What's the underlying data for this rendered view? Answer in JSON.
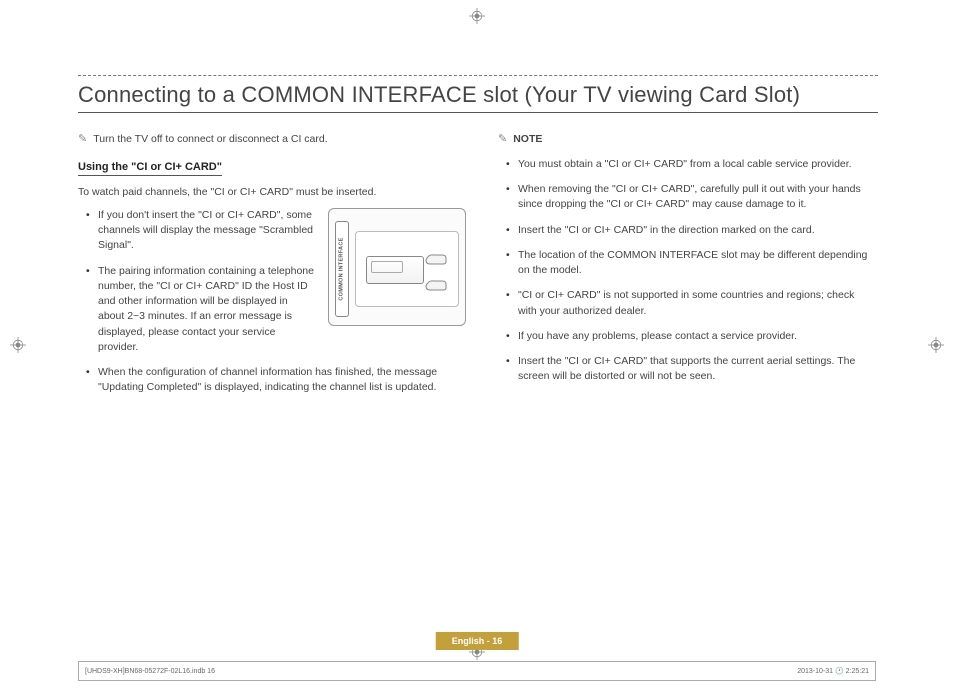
{
  "title": "Connecting to a COMMON INTERFACE slot (Your TV viewing Card Slot)",
  "left": {
    "top_note": "Turn the TV off to connect or disconnect a CI card.",
    "subhead": "Using  the \"CI or CI+ CARD\"",
    "intro": "To watch paid channels, the \"CI or CI+ CARD\" must be inserted.",
    "bullets_top": [
      "If you don't insert the \"CI or CI+ CARD\", some channels will display the message \"Scrambled Signal\".",
      "The pairing information containing a telephone number, the \"CI or CI+ CARD\" ID the Host ID and other information will be displayed in about 2~3 minutes. If an error message is displayed, please contact your service provider."
    ],
    "bullet_full": "When the configuration of channel information has finished, the message \"Updating Completed\" is displayed, indicating the channel list is updated.",
    "diagram_label": "COMMON INTERFACE"
  },
  "right": {
    "note_label": "NOTE",
    "bullets": [
      "You must obtain a \"CI or CI+ CARD\" from a local cable service provider.",
      "When removing the \"CI or CI+ CARD\", carefully pull it out with your hands since dropping the \"CI or CI+ CARD\" may cause damage to it.",
      "Insert the \"CI or CI+ CARD\" in the direction marked on the card.",
      "The location of the COMMON INTERFACE slot may be different depending on the model.",
      "\"CI or CI+ CARD\" is not supported in some countries and regions; check with your authorized dealer.",
      "If you have any problems, please contact a service provider.",
      "Insert the \"CI or CI+ CARD\" that supports the current aerial settings. The screen will be distorted or will not be seen."
    ]
  },
  "footer": {
    "page_label": "English - 16",
    "indd": "[UHDS9-XH]BN68-05272F-02L16.indb   16",
    "timestamp": "2013-10-31   🕐 2:25:21"
  }
}
